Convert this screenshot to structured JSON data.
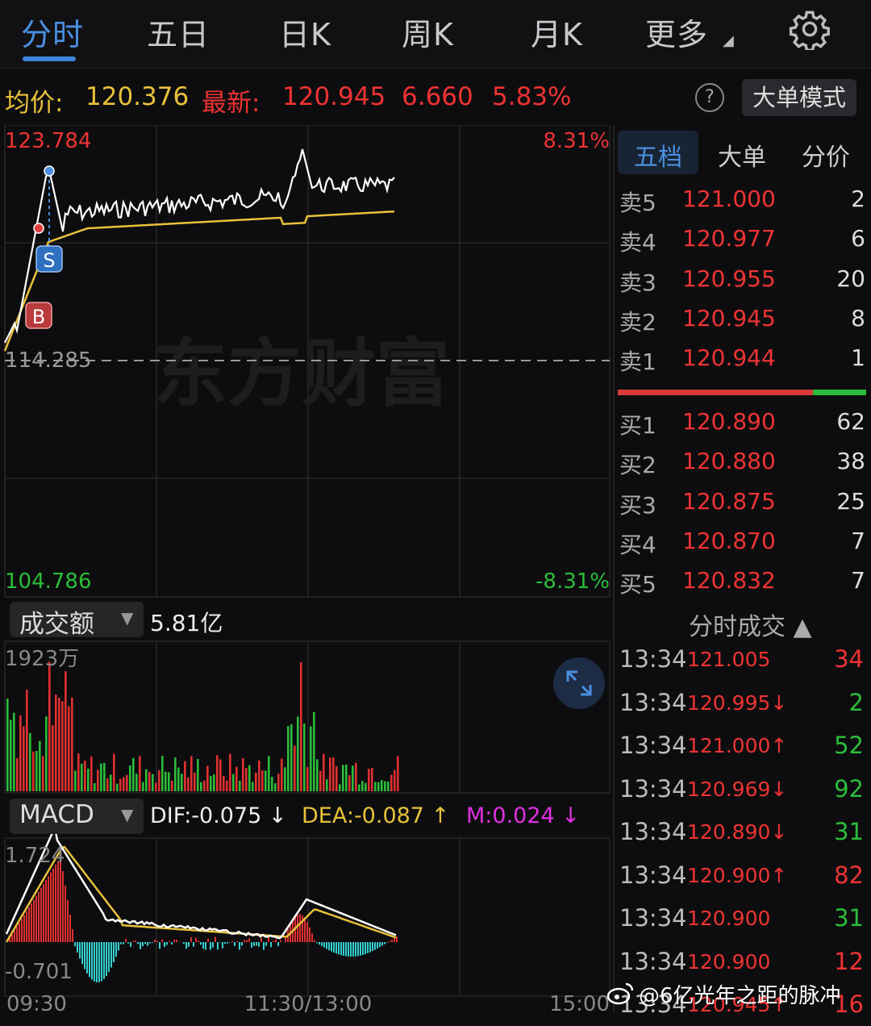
{
  "tabs": [
    "分时",
    "五日",
    "日K",
    "周K",
    "月K",
    "更多"
  ],
  "info": {
    "avg_label": "均价:",
    "avg_value": "120.376",
    "last_label": "最新:",
    "last_value": "120.945",
    "change": "6.660",
    "change_pct": "5.83%",
    "help": "?",
    "bigorder_mode": "大单模式"
  },
  "price_chart": {
    "top_price": "123.784",
    "top_pct": "8.31%",
    "mid_price": "114.285",
    "bottom_price": "104.786",
    "bottom_pct": "-8.31%",
    "watermark": "东方财富",
    "marker_s": "S",
    "marker_b": "B"
  },
  "volume": {
    "selector": "成交额",
    "total": "5.81亿",
    "max_label": "1923万"
  },
  "macd": {
    "selector": "MACD",
    "dif": "DIF:-0.075 ↓",
    "dea": "DEA:-0.087 ↑",
    "m": "M:0.024 ↓",
    "top_label": "1.724",
    "bottom_label": "-0.701"
  },
  "time_axis": [
    "09:30",
    "11:30/13:00",
    "15:00"
  ],
  "orderbook": {
    "tabs": [
      "五档",
      "大单",
      "分价"
    ],
    "asks": [
      {
        "label": "卖5",
        "price": "121.000",
        "vol": "2"
      },
      {
        "label": "卖4",
        "price": "120.977",
        "vol": "6"
      },
      {
        "label": "卖3",
        "price": "120.955",
        "vol": "20"
      },
      {
        "label": "卖2",
        "price": "120.945",
        "vol": "8"
      },
      {
        "label": "卖1",
        "price": "120.944",
        "vol": "1"
      }
    ],
    "bids": [
      {
        "label": "买1",
        "price": "120.890",
        "vol": "62"
      },
      {
        "label": "买2",
        "price": "120.880",
        "vol": "38"
      },
      {
        "label": "买3",
        "price": "120.875",
        "vol": "25"
      },
      {
        "label": "买4",
        "price": "120.870",
        "vol": "7"
      },
      {
        "label": "买5",
        "price": "120.832",
        "vol": "7"
      }
    ]
  },
  "trades": {
    "title": "分时成交 ▲",
    "rows": [
      {
        "time": "13:34",
        "price": "121.005",
        "vol": "34",
        "color": "#ee3333"
      },
      {
        "time": "13:34",
        "price": "120.995↓",
        "vol": "2",
        "color": "#2bbd3a"
      },
      {
        "time": "13:34",
        "price": "121.000↑",
        "vol": "52",
        "color": "#2bbd3a"
      },
      {
        "time": "13:34",
        "price": "120.969↓",
        "vol": "92",
        "color": "#2bbd3a"
      },
      {
        "time": "13:34",
        "price": "120.890↓",
        "vol": "31",
        "color": "#2bbd3a"
      },
      {
        "time": "13:34",
        "price": "120.900↑",
        "vol": "82",
        "color": "#ee3333"
      },
      {
        "time": "13:34",
        "price": "120.900",
        "vol": "31",
        "color": "#2bbd3a"
      },
      {
        "time": "13:34",
        "price": "120.900",
        "vol": "12",
        "color": "#ee3333"
      },
      {
        "time": "13:34",
        "price": "120.945↑",
        "vol": "16",
        "color": "#ee3333"
      }
    ]
  },
  "credit": "@6亿光年之距的脉冲",
  "colors": {
    "up": "#ee3333",
    "down": "#2bbd3a",
    "accent": "#3d85d8",
    "avg": "#e8c13a"
  },
  "icons": {
    "settings": "gear-icon",
    "expand": "expand-icon",
    "help": "help-icon",
    "weibo": "weibo-icon"
  }
}
